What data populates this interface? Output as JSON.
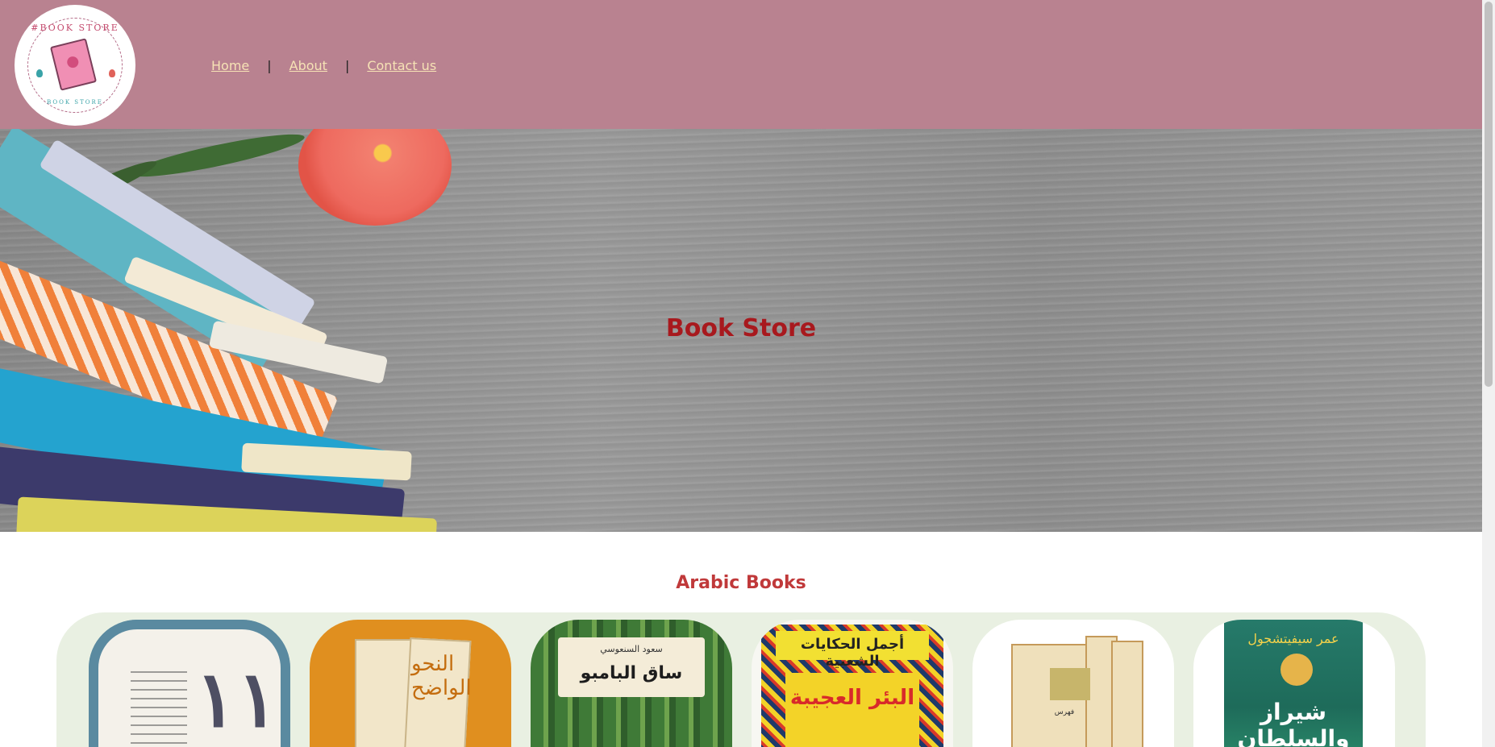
{
  "logo": {
    "top_text": "#BOOK STORE",
    "bottom_text": "BOOK STORE"
  },
  "nav": {
    "home": "Home",
    "about": "About",
    "contact": "Contact us",
    "separator": "|"
  },
  "hero": {
    "title": "Book Store"
  },
  "section": {
    "title": "Arabic Books"
  },
  "books": [
    {
      "big": "١١"
    },
    {
      "title": "النحو الواضح"
    },
    {
      "author": "سعود السنعوسي",
      "title": "ساق البامبو"
    },
    {
      "top": "أجمل الحكايات الشعبية",
      "title": "البئر العجيبة"
    },
    {
      "subtitle": "فهرس"
    },
    {
      "author": "عمر سيفيتشجول",
      "title": "شيراز والسلطان"
    }
  ],
  "colors": {
    "header": "#b98290",
    "nav_link": "#f6e2b5",
    "hero_title": "#a8191e",
    "section_title": "#c0393a",
    "shelf": "#e9f0e2"
  }
}
